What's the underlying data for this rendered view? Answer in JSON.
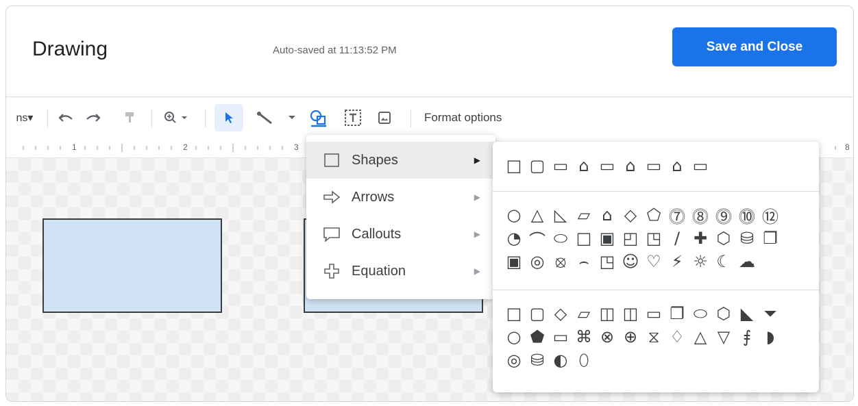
{
  "header": {
    "title": "Drawing",
    "autosave": "Auto-saved at 11:13:52 PM",
    "save_button": "Save and Close",
    "accent_color": "#1a73e8"
  },
  "toolbar": {
    "actions_label": "ns▾",
    "format_options": "Format options",
    "icons": [
      "undo-icon",
      "redo-icon",
      "paint-format-icon",
      "zoom-icon",
      "select-icon",
      "line-icon",
      "shape-icon",
      "text-box-icon",
      "image-icon"
    ]
  },
  "ruler": {
    "marks": [
      "1",
      "2",
      "3",
      "8"
    ]
  },
  "menu": {
    "items": [
      {
        "label": "Shapes",
        "icon": "square-icon",
        "arrow": "▶"
      },
      {
        "label": "Arrows",
        "icon": "arrow-icon",
        "arrow": "▶"
      },
      {
        "label": "Callouts",
        "icon": "callout-icon",
        "arrow": "▶"
      },
      {
        "label": "Equation",
        "icon": "plus-icon",
        "arrow": "▶"
      }
    ]
  },
  "shapes_panel": {
    "group1_row1": [
      "□",
      "▢",
      "▭",
      "⌂",
      "▭",
      "⌂",
      "▭",
      "⌂",
      "▭"
    ],
    "group2_row1": [
      "○",
      "△",
      "◺",
      "▱",
      "⌂",
      "◇",
      "⬠",
      "⓻",
      "⓼",
      "⓽",
      "⓾",
      "⑫"
    ],
    "group2_row2": [
      "◔",
      "⌒",
      "⬭",
      "□",
      "▣",
      "◰",
      "◳",
      "∕",
      "✚",
      "⬡",
      "⛁",
      "❐"
    ],
    "group2_row3": [
      "▣",
      "◎",
      "⦻",
      "⌢",
      "◳",
      "☺",
      "♡",
      "⚡",
      "☼",
      "☾",
      "☁"
    ],
    "group3_row1": [
      "□",
      "▢",
      "◇",
      "▱",
      "◫",
      "◫",
      "▭",
      "❐",
      "⬭",
      "⬡",
      "◣",
      "⏷"
    ],
    "group3_row2": [
      "○",
      "⬟",
      "▭",
      "⌘",
      "⊗",
      "⊕",
      "⧖",
      "♢",
      "△",
      "▽",
      "⨎",
      "◗"
    ],
    "group3_row3": [
      "◎",
      "⛁",
      "◐",
      "⬯"
    ]
  }
}
